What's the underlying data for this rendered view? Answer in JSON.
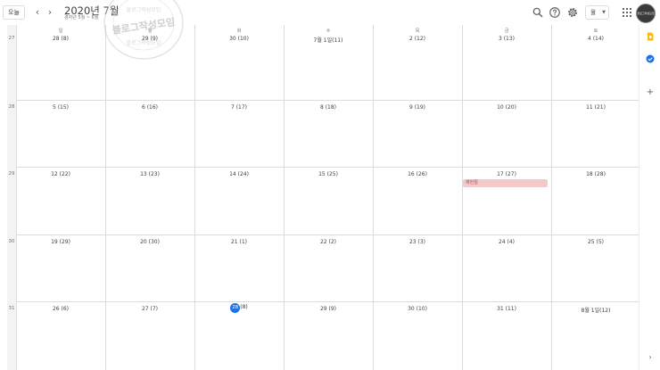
{
  "header": {
    "today_label": "오늘",
    "prev_icon": "chevron-left-icon",
    "next_icon": "chevron-right-icon",
    "month_title": "2020년 7월",
    "month_subtitle": "경자년 5월 ~ 6월",
    "search_icon": "search-icon",
    "help_icon": "help-icon",
    "settings_icon": "gear-icon",
    "view_label": "월",
    "apps_icon": "apps-grid-icon",
    "badge_text": "블로그작성모임"
  },
  "calendar": {
    "day_names": [
      "일",
      "월",
      "화",
      "수",
      "목",
      "금",
      "토"
    ],
    "weeks": [
      {
        "number": "27",
        "days": [
          "28 (8)",
          "29 (9)",
          "30 (10)",
          "7월 1일(11)",
          "2 (12)",
          "3 (13)",
          "4 (14)"
        ]
      },
      {
        "number": "28",
        "days": [
          "5 (15)",
          "6 (16)",
          "7 (17)",
          "8 (18)",
          "9 (19)",
          "10 (20)",
          "11 (21)"
        ]
      },
      {
        "number": "29",
        "days": [
          "12 (22)",
          "13 (23)",
          "14 (24)",
          "15 (25)",
          "16 (26)",
          "17 (27)",
          "18 (28)"
        ]
      },
      {
        "number": "30",
        "days": [
          "19 (29)",
          "20 (30)",
          "21 (1)",
          "22 (2)",
          "23 (3)",
          "24 (4)",
          "25 (5)"
        ]
      },
      {
        "number": "31",
        "days": [
          "26 (6)",
          "27 (7)",
          "",
          "29 (9)",
          "30 (10)",
          "31 (11)",
          "8월 1일(12)"
        ]
      }
    ],
    "today": {
      "day": "28",
      "lunar": "(8)"
    },
    "events": [
      {
        "label": "제헌절",
        "week": 2,
        "day": 5,
        "color": "#f6c8c8"
      }
    ]
  },
  "watermark": {
    "text_top": "블로그작성모임",
    "text_bottom": "블로그작성모임"
  },
  "side_panel": {
    "keep_icon": "keep-icon",
    "tasks_icon": "tasks-icon",
    "add_icon": "plus-icon",
    "collapse_icon": "chevron-right-icon"
  },
  "colors": {
    "accent": "#1a73e8",
    "grid_line": "#dadce0",
    "event_bg": "#f6c8c8",
    "keep_yellow": "#fbbc04"
  }
}
